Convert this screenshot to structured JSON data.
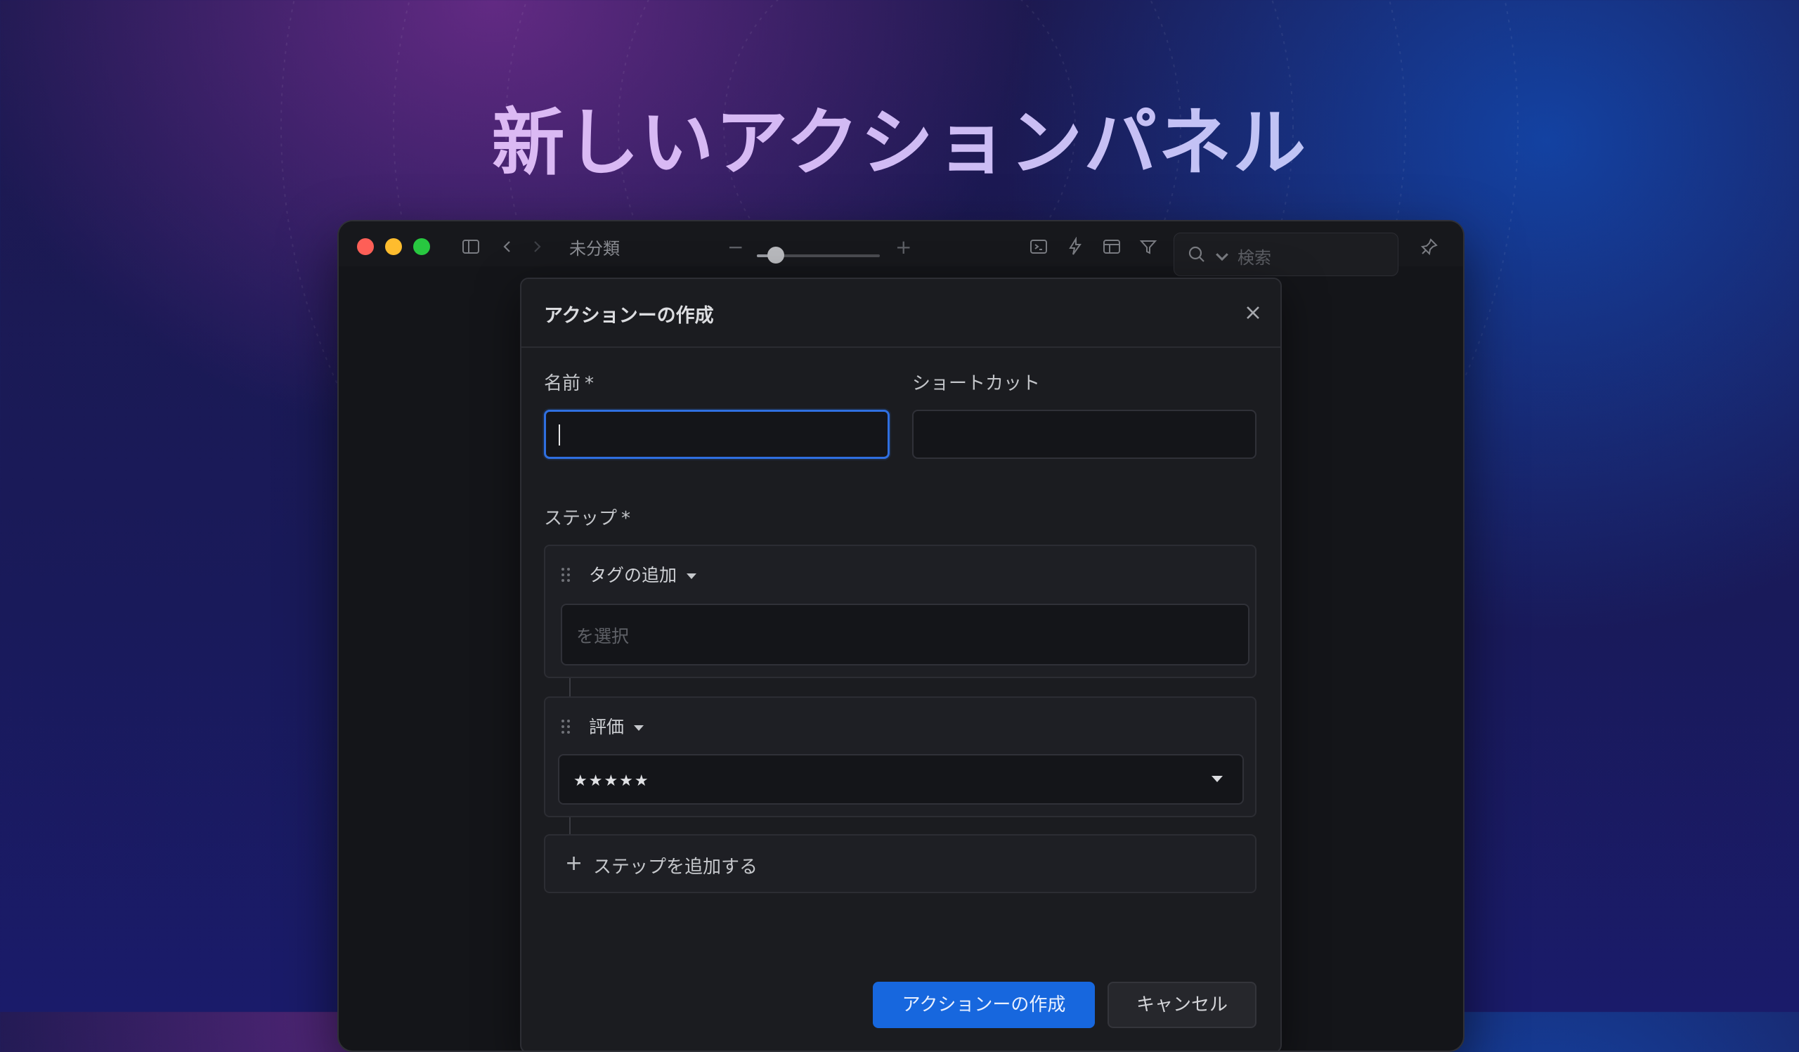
{
  "hero": {
    "title": "新しいアクションパネル"
  },
  "titlebar": {
    "breadcrumb": "未分類",
    "zoom": {
      "minus": "−",
      "plus": "+",
      "level": 0.18
    },
    "search_placeholder": "検索"
  },
  "dialog": {
    "title": "アクションーの作成",
    "name_field": {
      "label": "名前",
      "required": "*",
      "value": ""
    },
    "shortcut_field": {
      "label": "ショートカット",
      "value": ""
    },
    "steps_section": {
      "label": "ステップ",
      "required": "*"
    },
    "steps": [
      {
        "name": "タグの追加",
        "input_placeholder": "を選択"
      },
      {
        "name": "評価",
        "select_value": "★★★★★"
      }
    ],
    "add_step_label": "ステップを追加する",
    "add_step_icon": "plus-icon",
    "create_button": "アクションーの作成",
    "cancel_button": "キャンセル"
  },
  "colors": {
    "accent": "#1767de",
    "traffic_close": "#fe5f57",
    "traffic_minimize": "#febc2e",
    "traffic_maximize": "#28c840"
  }
}
